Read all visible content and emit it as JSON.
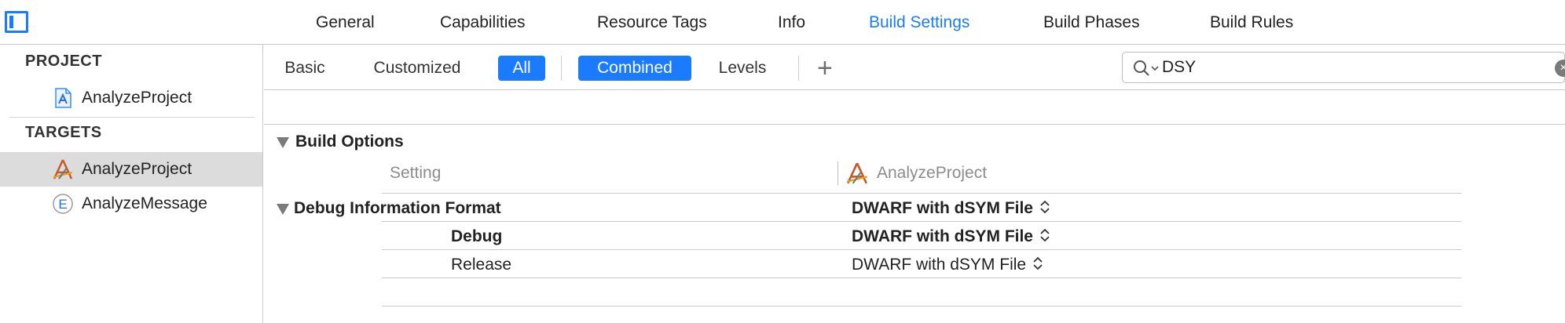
{
  "tabs": [
    {
      "label": "General"
    },
    {
      "label": "Capabilities"
    },
    {
      "label": "Resource Tags"
    },
    {
      "label": "Info"
    },
    {
      "label": "Build Settings"
    },
    {
      "label": "Build Phases"
    },
    {
      "label": "Build Rules"
    }
  ],
  "active_tab": "Build Settings",
  "sidebar": {
    "project_header": "PROJECT",
    "project_item": "AnalyzeProject",
    "targets_header": "TARGETS",
    "targets": [
      {
        "label": "AnalyzeProject",
        "icon": "app-target-icon",
        "selected": true
      },
      {
        "label": "AnalyzeMessage",
        "icon": "extension-target-icon",
        "selected": false
      }
    ]
  },
  "filters": {
    "basic": "Basic",
    "customized": "Customized",
    "all": "All",
    "combined": "Combined",
    "levels": "Levels",
    "add": "+"
  },
  "search": {
    "value": "DSY",
    "clear": "×"
  },
  "section": {
    "title": "Build Options",
    "col_setting": "Setting",
    "col_target": "AnalyzeProject"
  },
  "setting": {
    "name": "Debug Information Format",
    "value": "DWARF with dSYM File",
    "rows": [
      {
        "name": "Debug",
        "value": "DWARF with dSYM File"
      },
      {
        "name": "Release",
        "value": "DWARF with dSYM File"
      }
    ]
  },
  "colors": {
    "accent": "#1a7bff",
    "selection": "#dcdcdc"
  }
}
